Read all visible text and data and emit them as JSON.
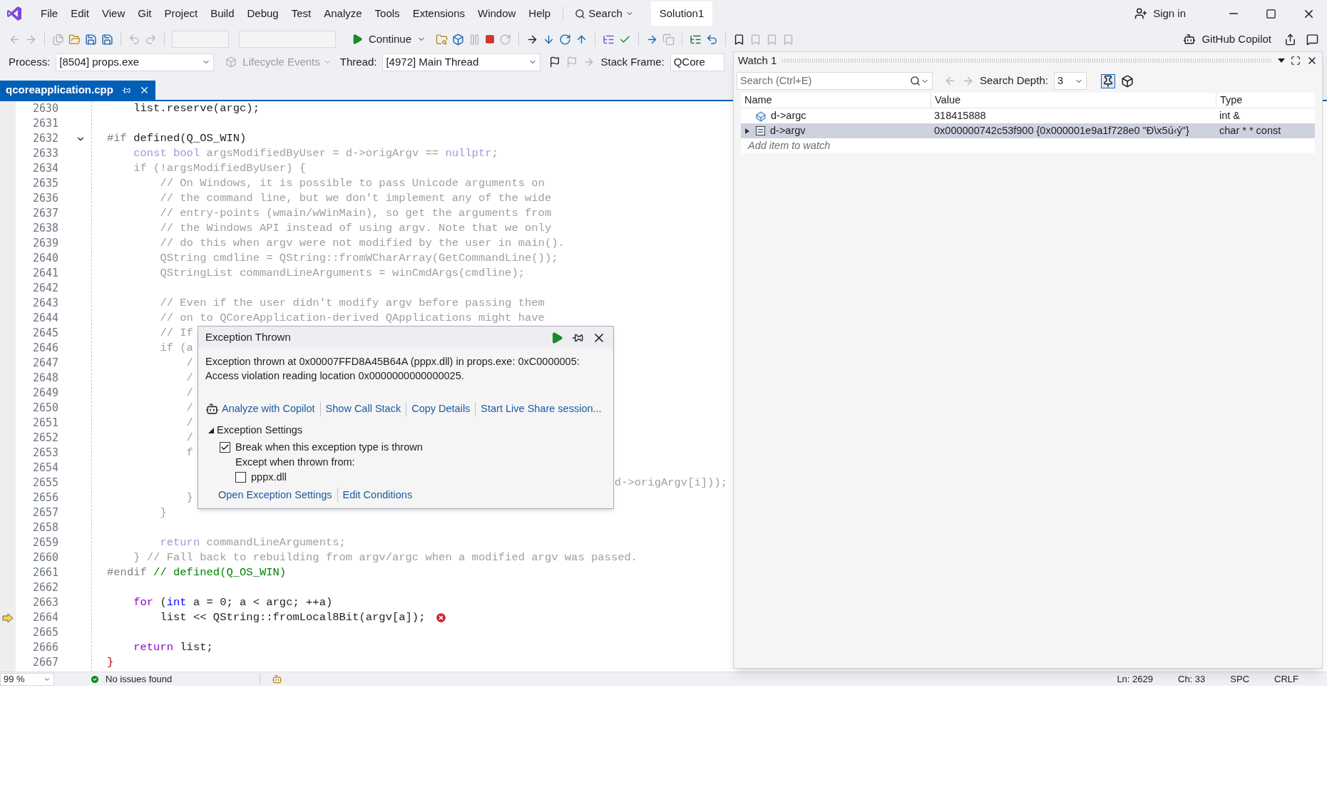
{
  "menu": [
    "File",
    "Edit",
    "View",
    "Git",
    "Project",
    "Build",
    "Debug",
    "Test",
    "Analyze",
    "Tools",
    "Extensions",
    "Window",
    "Help"
  ],
  "search_button": "Search",
  "solution_name": "Solution1",
  "sign_in": "Sign in",
  "toolbar": {
    "continue": "Continue",
    "copilot": "GitHub Copilot"
  },
  "debug_bar": {
    "process_label": "Process:",
    "process": "[8504] props.exe",
    "lifecycle": "Lifecycle Events",
    "thread_label": "Thread:",
    "thread": "[4972] Main Thread",
    "stack_frame_label": "Stack Frame:",
    "stack_frame": "QCore"
  },
  "editor": {
    "tabs": [
      {
        "label": "qcoreapplication.cpp",
        "selected": true
      }
    ],
    "lines": [
      {
        "number": "2630",
        "segments": [
          {
            "text": "    list.reserve(argc);",
            "kind": "plain"
          }
        ]
      },
      {
        "number": "2631"
      },
      {
        "number": "2632",
        "fold": true,
        "segments": [
          {
            "text": "#if",
            "kind": "preproc"
          },
          {
            "text": " defined(Q_OS_WIN)",
            "kind": "plain"
          }
        ]
      },
      {
        "number": "2633",
        "segments": [
          {
            "text": "    const bool",
            "kind": "inactive_keyword"
          },
          {
            "text": " argsModifiedByUser = d->origArgv == ",
            "kind": "inactive"
          },
          {
            "text": "nullptr",
            "kind": "inactive_keyword"
          },
          {
            "text": ";",
            "kind": "inactive"
          }
        ]
      },
      {
        "number": "2634",
        "segments": [
          {
            "text": "    if (!argsModifiedByUser) {",
            "kind": "inactive"
          }
        ]
      },
      {
        "number": "2635",
        "segments": [
          {
            "text": "        // On Windows, it is possible to pass Unicode arguments on",
            "kind": "inactive"
          }
        ]
      },
      {
        "number": "2636",
        "segments": [
          {
            "text": "        // the command line, but we don't implement any of the wide",
            "kind": "inactive"
          }
        ]
      },
      {
        "number": "2637",
        "segments": [
          {
            "text": "        // entry-points (wmain/wWinMain), so get the arguments from",
            "kind": "inactive"
          }
        ]
      },
      {
        "number": "2638",
        "segments": [
          {
            "text": "        // the Windows API instead of using argv. Note that we only",
            "kind": "inactive"
          }
        ]
      },
      {
        "number": "2639",
        "segments": [
          {
            "text": "        // do this when argv were not modified by the user in main().",
            "kind": "inactive"
          }
        ]
      },
      {
        "number": "2640",
        "segments": [
          {
            "text": "        QString cmdline = QString::fromWCharArray(GetCommandLine());",
            "kind": "inactive"
          }
        ]
      },
      {
        "number": "2641",
        "segments": [
          {
            "text": "        QStringList commandLineArguments = winCmdArgs(cmdline);",
            "kind": "inactive"
          }
        ]
      },
      {
        "number": "2642"
      },
      {
        "number": "2643",
        "segments": [
          {
            "text": "        // Even if the user didn't modify argv before passing them",
            "kind": "inactive"
          }
        ]
      },
      {
        "number": "2644",
        "segments": [
          {
            "text": "        // on to QCoreApplication-derived QApplications might have",
            "kind": "inactive"
          }
        ]
      },
      {
        "number": "2645",
        "segments": [
          {
            "text": "        // If",
            "kind": "inactive"
          }
        ]
      },
      {
        "number": "2646",
        "segments": [
          {
            "text": "        if (a",
            "kind": "inactive"
          }
        ]
      },
      {
        "number": "2647",
        "segments": [
          {
            "text": "            /",
            "kind": "inactive"
          }
        ]
      },
      {
        "number": "2648",
        "segments": [
          {
            "text": "            /",
            "kind": "inactive"
          }
        ]
      },
      {
        "number": "2649",
        "segments": [
          {
            "text": "            /",
            "kind": "inactive"
          }
        ]
      },
      {
        "number": "2650",
        "segments": [
          {
            "text": "            /",
            "kind": "inactive"
          }
        ]
      },
      {
        "number": "2651",
        "segments": [
          {
            "text": "            /",
            "kind": "inactive"
          }
        ]
      },
      {
        "number": "2652",
        "segments": [
          {
            "text": "            /",
            "kind": "inactive"
          }
        ]
      },
      {
        "number": "2653",
        "segments": [
          {
            "text": "            f",
            "kind": "inactive"
          }
        ]
      },
      {
        "number": "2654"
      },
      {
        "number": "2655",
        "tail": "d->origArgv[i]));"
      },
      {
        "number": "2656",
        "segments": [
          {
            "text": "            }",
            "kind": "inactive"
          }
        ]
      },
      {
        "number": "2657",
        "segments": [
          {
            "text": "        }",
            "kind": "inactive"
          }
        ]
      },
      {
        "number": "2658"
      },
      {
        "number": "2659",
        "segments": [
          {
            "text": "        return",
            "kind": "inactive_keyword"
          },
          {
            "text": " commandLineArguments;",
            "kind": "inactive"
          }
        ]
      },
      {
        "number": "2660",
        "segments": [
          {
            "text": "    } // Fall back to rebuilding from argv/argc when a modified argv was passed.",
            "kind": "inactive"
          }
        ]
      },
      {
        "number": "2661",
        "segments": [
          {
            "text": "#endif",
            "kind": "preproc"
          },
          {
            "text": " // defined(Q_OS_WIN)",
            "kind": "comment"
          }
        ]
      },
      {
        "number": "2662"
      },
      {
        "number": "2663",
        "segments": [
          {
            "text": "    for",
            "kind": "control"
          },
          {
            "text": " (",
            "kind": "plain"
          },
          {
            "text": "int",
            "kind": "keyword"
          },
          {
            "text": " a = 0; a < argc; ++a)",
            "kind": "plain"
          }
        ]
      },
      {
        "number": "2664",
        "current": true,
        "error": true,
        "segments": [
          {
            "text": "        list << QString::fromLocal8Bit(argv[a]);",
            "kind": "plain"
          }
        ]
      },
      {
        "number": "2665"
      },
      {
        "number": "2666",
        "segments": [
          {
            "text": "    return",
            "kind": "control"
          },
          {
            "text": " list;",
            "kind": "plain"
          }
        ]
      },
      {
        "number": "2667",
        "segments": [
          {
            "text": "}",
            "kind": "brace"
          }
        ]
      }
    ]
  },
  "exception_popup": {
    "title": "Exception Thrown",
    "message": "Exception thrown at 0x00007FFD8A45B64A (pppx.dll) in props.exe: 0xC0000005: Access violation reading location 0x0000000000000025.",
    "actions": [
      "Analyze with Copilot",
      "Show Call Stack",
      "Copy Details",
      "Start Live Share session..."
    ],
    "settings": {
      "title": "Exception Settings",
      "expanded": true,
      "break_label": "Break when this exception type is thrown",
      "break_checked": true,
      "except_label": "Except when thrown from:",
      "modules": [
        {
          "label": "pppx.dll",
          "checked": false
        }
      ]
    },
    "links": [
      "Open Exception Settings",
      "Edit Conditions"
    ]
  },
  "watch": {
    "title": "Watch 1",
    "search_placeholder": "Search (Ctrl+E)",
    "depth_label": "Search Depth:",
    "depth": "3",
    "columns": [
      "Name",
      "Value",
      "Type"
    ],
    "rows": [
      {
        "kind": "value",
        "name": "d->argc",
        "value": "318415888",
        "type": "int &",
        "expandable": false,
        "selected": false
      },
      {
        "kind": "pointer",
        "name": "d->argv",
        "value": "0x000000742c53f900 {0x000001e9a1f728e0 \"Ð\\x5ú‹ý\"}",
        "type": "char * * const",
        "expandable": true,
        "selected": true
      }
    ],
    "add_placeholder": "Add item to watch"
  },
  "status_bar": {
    "zoom": "99 %",
    "issues": "No issues found",
    "line": "Ln: 2629",
    "column": "Ch: 33",
    "spacing": "SPC",
    "ending": "CRLF"
  }
}
